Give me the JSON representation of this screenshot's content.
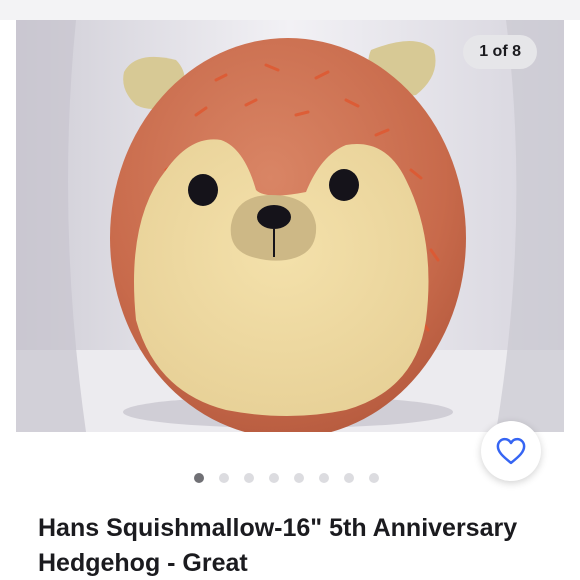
{
  "gallery": {
    "counter": "1 of 8",
    "total_images": 8,
    "current_index": 0,
    "subject_icon": "hedgehog-plush-photo"
  },
  "favorite": {
    "icon": "heart-icon",
    "color": "#3665f3"
  },
  "listing": {
    "title": "Hans Squishmallow-16\" 5th Anniversary Hedgehog - Great"
  }
}
